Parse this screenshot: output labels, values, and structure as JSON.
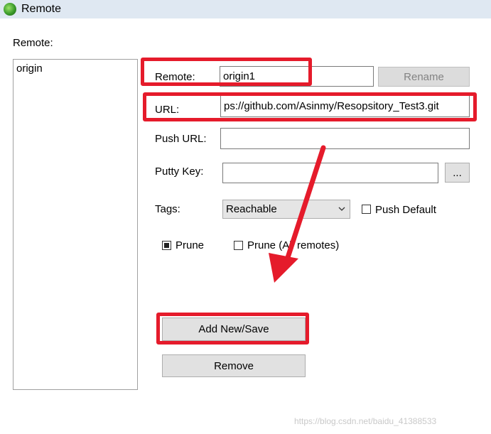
{
  "window": {
    "title": "Remote"
  },
  "remotes_label": "Remote:",
  "remotes_list": [
    "origin"
  ],
  "form": {
    "remote_label": "Remote:",
    "remote_value": "origin1",
    "rename_button": "Rename",
    "url_label": "URL:",
    "url_value": "ps://github.com/Asinmy/Resopsitory_Test3.git",
    "push_url_label": "Push URL:",
    "push_url_value": "",
    "putty_key_label": "Putty Key:",
    "putty_key_value": "",
    "browse_button": "...",
    "tags_label": "Tags:",
    "tags_selected": "Reachable",
    "push_default_label": "Push Default",
    "push_default_checked": false,
    "prune_label": "Prune",
    "prune_checked": true,
    "prune_all_label": "Prune (All remotes)",
    "prune_all_checked": false,
    "add_save_button": "Add New/Save",
    "remove_button": "Remove"
  },
  "watermark": "https://blog.csdn.net/baidu_41388533",
  "colors": {
    "annotation": "#e51b2b",
    "titlebar": "#dfe8f2"
  }
}
